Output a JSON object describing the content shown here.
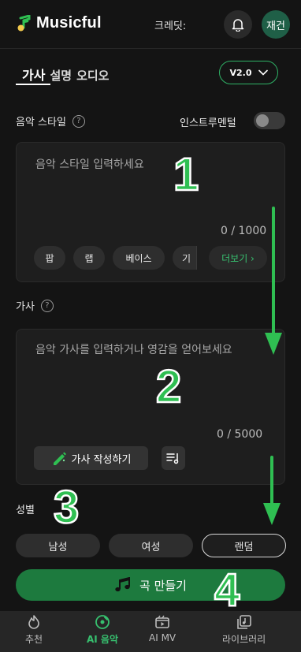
{
  "header": {
    "brand": "Musicful",
    "credits_label": "크레딧:",
    "avatar_text": "재건",
    "icons": {
      "bell": "bell-icon",
      "logo": "music-note-logo"
    }
  },
  "tabs": [
    {
      "label": "가사",
      "active": true
    },
    {
      "label": "설명",
      "active": false
    },
    {
      "label": "오디오",
      "active": false
    }
  ],
  "version": {
    "selected": "V2.0"
  },
  "style_section": {
    "label": "음악 스타일",
    "help": "?",
    "instrumental_label": "인스트루멘털",
    "instrumental_on": false,
    "placeholder": "음악 스타일 입력하세요",
    "counter": "0 / 1000",
    "chips": [
      "팝",
      "랩",
      "베이스",
      "기"
    ],
    "more_label": "더보기 ›"
  },
  "lyrics_section": {
    "label": "가사",
    "help": "?",
    "placeholder": "음악 가사를 입력하거나 영감을 얻어보세요",
    "counter": "0 / 5000",
    "write_button": "가사 작성하기"
  },
  "gender_section": {
    "label": "성별",
    "options": [
      "남성",
      "여성",
      "랜덤"
    ],
    "selected": "랜덤"
  },
  "create_button": {
    "label": "곡 만들기",
    "icon": "music-notes-icon"
  },
  "bottom_nav": [
    {
      "label": "추천",
      "icon": "flame-icon",
      "active": false
    },
    {
      "label": "AI 음악",
      "icon": "disc-icon",
      "active": true
    },
    {
      "label": "AI MV",
      "icon": "video-icon",
      "active": false
    },
    {
      "label": "라이브러리",
      "icon": "library-icon",
      "active": false
    }
  ],
  "annotations": [
    "1",
    "2",
    "3",
    "4"
  ],
  "colors": {
    "accent": "#2fb266",
    "create": "#1d7a3e",
    "annotation": "#2fbf52"
  }
}
